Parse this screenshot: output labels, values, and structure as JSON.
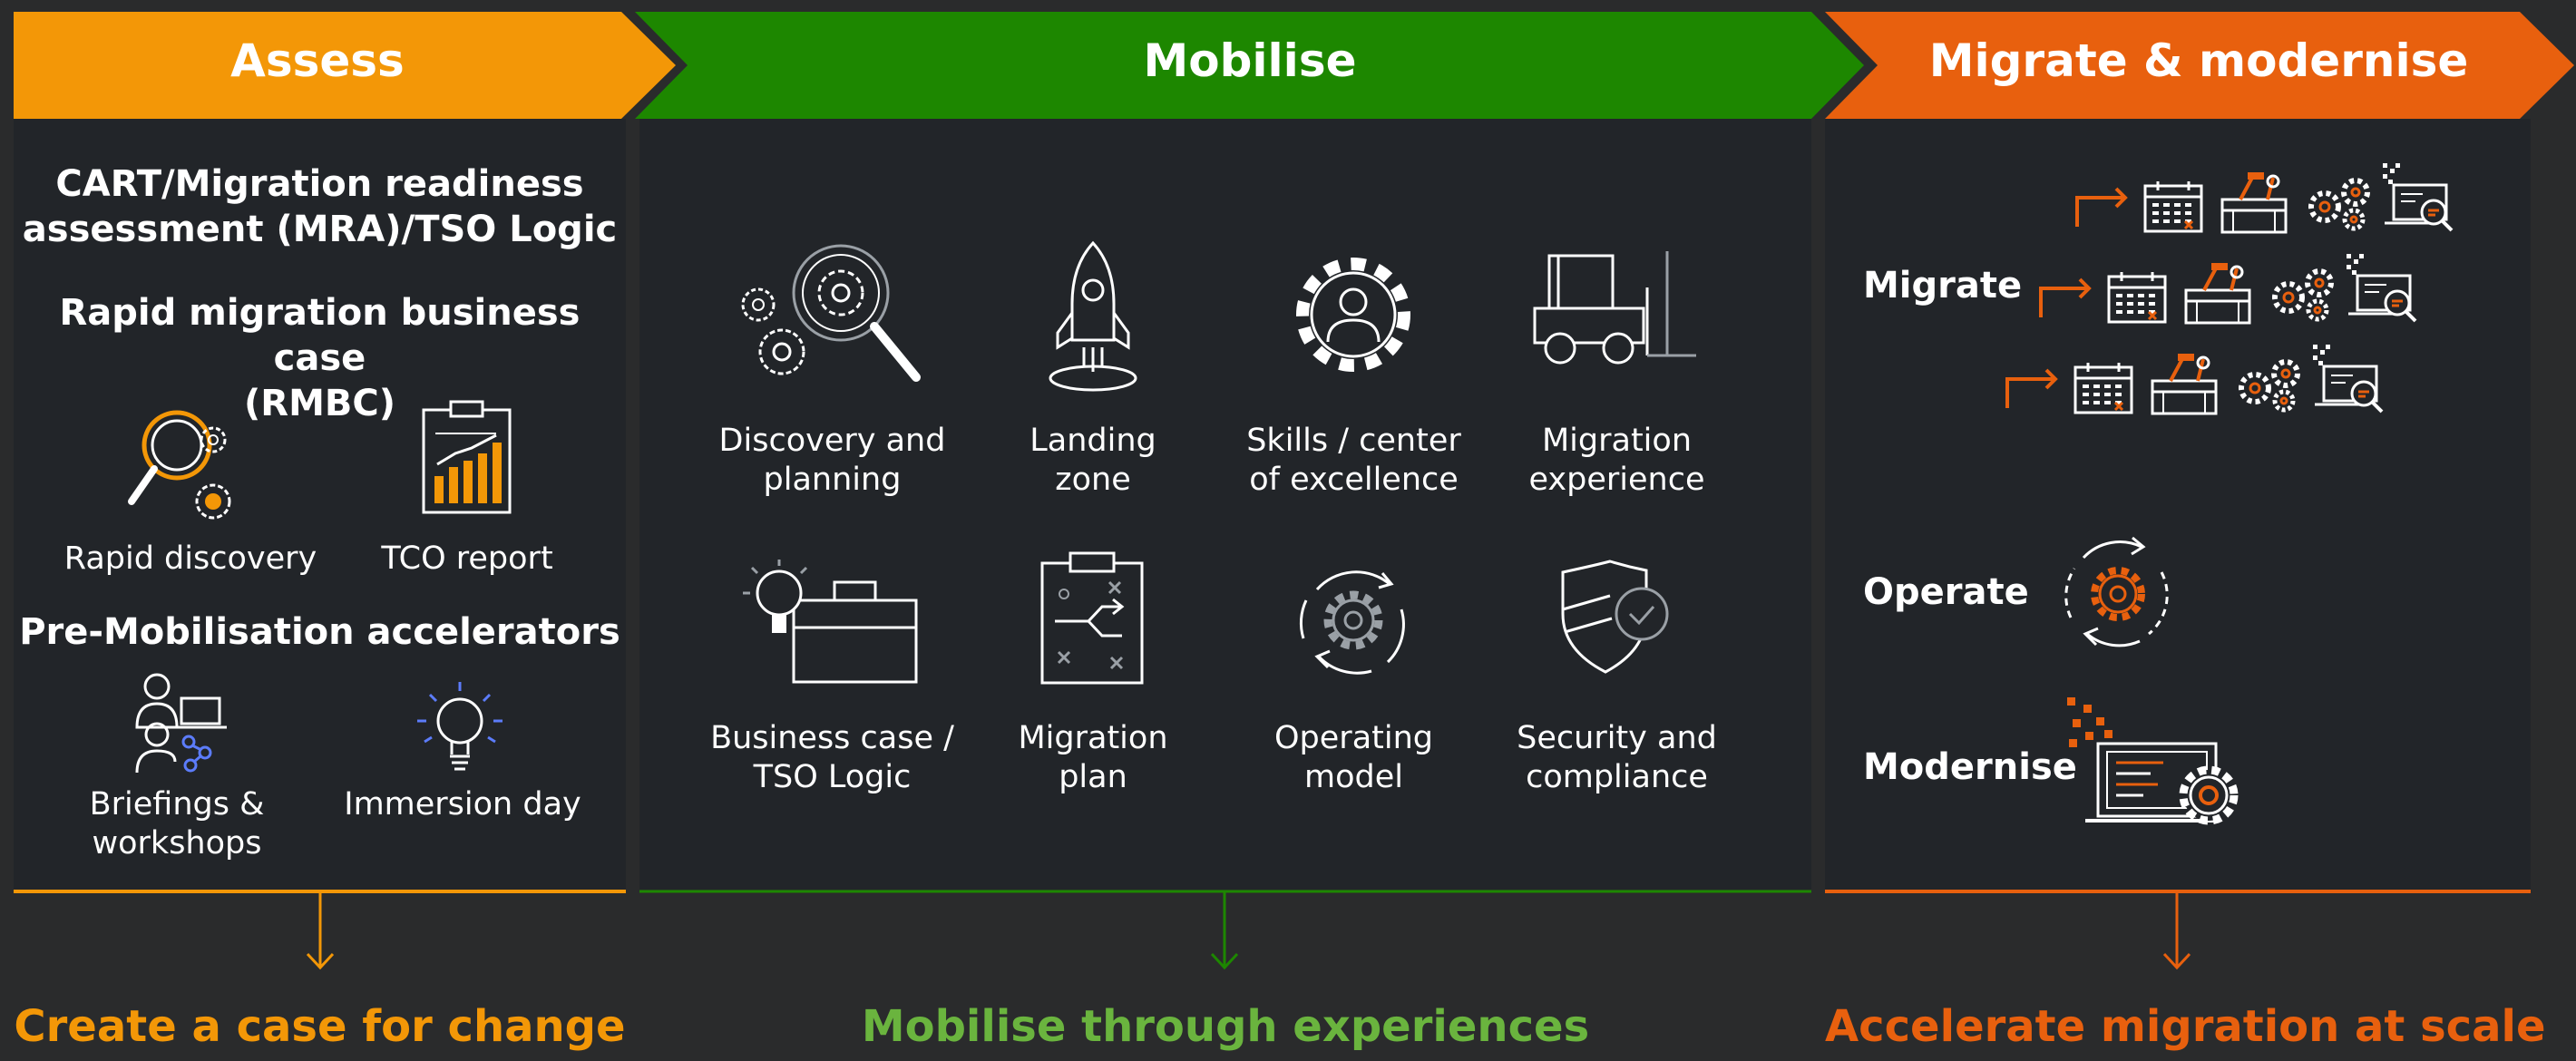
{
  "phases": [
    {
      "name": "Assess",
      "color": "#f39707"
    },
    {
      "name": "Mobilise",
      "color": "#1d8700"
    },
    {
      "name": "Migrate & modernise",
      "color": "#e8600e"
    }
  ],
  "assess": {
    "heading_cart": [
      "CART/Migration readiness",
      "assessment (MRA)/TSO Logic"
    ],
    "heading_rmbc": [
      "Rapid migration business case",
      "(RMBC)"
    ],
    "items_top": [
      "Rapid discovery",
      "TCO report"
    ],
    "heading_pre": "Pre-Mobilisation accelerators",
    "items_bottom": [
      [
        "Briefings &",
        "workshops"
      ],
      "Immersion day"
    ],
    "footer": "Create a case for change"
  },
  "mobilise": {
    "items": [
      [
        "Discovery and",
        "planning"
      ],
      [
        "Landing",
        "zone"
      ],
      [
        "Skills / center",
        "of excellence"
      ],
      [
        "Migration",
        "experience"
      ],
      [
        "Business case /",
        "TSO Logic"
      ],
      [
        "Migration",
        "plan"
      ],
      [
        "Operating",
        "model"
      ],
      [
        "Security and",
        "compliance"
      ]
    ],
    "footer": "Mobilise through experiences"
  },
  "migrate": {
    "labels": [
      "Migrate",
      "Operate",
      "Modernise"
    ],
    "footer": "Accelerate migration at scale"
  },
  "icons": [
    "magnifier-gears-icon",
    "bar-chart-report-icon",
    "people-network-icon",
    "lightbulb-icon",
    "gears-magnifier-icon",
    "rocket-icon",
    "gear-person-icon",
    "forklift-icon",
    "lightbulb-briefcase-icon",
    "clipboard-plan-icon",
    "gear-cycle-icon",
    "shield-check-icon",
    "calendar-icon",
    "toolbox-icon",
    "gears-icon",
    "laptop-search-icon",
    "code-laptop-gear-icon"
  ]
}
